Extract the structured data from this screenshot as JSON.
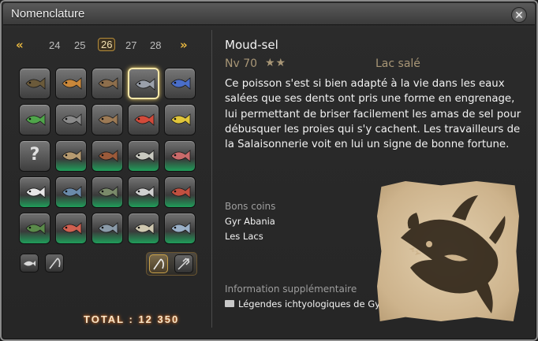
{
  "window": {
    "title": "Nomenclature",
    "close_icon": "crossed-close-icon"
  },
  "pager": {
    "prev_icon": "double-left-arrow-icon",
    "next_icon": "double-right-arrow-icon",
    "pages": [
      "24",
      "25",
      "26",
      "27",
      "28"
    ],
    "active_page": "26"
  },
  "grid": {
    "slots": [
      {
        "icon": "catfish-icon",
        "color": "#6b5a3a",
        "highlight": false,
        "selected": false
      },
      {
        "icon": "orange-fish-icon",
        "color": "#c9873a",
        "highlight": false,
        "selected": false
      },
      {
        "icon": "crab-icon",
        "color": "#8d6e4c",
        "highlight": false,
        "selected": false
      },
      {
        "icon": "gear-fish-icon",
        "color": "#9aa0aa",
        "highlight": false,
        "selected": true
      },
      {
        "icon": "blue-eel-icon",
        "color": "#4a6ec9",
        "highlight": false,
        "selected": false
      },
      {
        "icon": "green-dragon-fish-icon",
        "color": "#4fa54a",
        "highlight": false,
        "selected": false
      },
      {
        "icon": "grey-fish-icon",
        "color": "#8a8a8a",
        "highlight": false,
        "selected": false
      },
      {
        "icon": "octopus-icon",
        "color": "#9c7a55",
        "highlight": false,
        "selected": false
      },
      {
        "icon": "red-fish-icon",
        "color": "#d24a3a",
        "highlight": false,
        "selected": false
      },
      {
        "icon": "yellow-fish-icon",
        "color": "#e0c53a",
        "highlight": false,
        "selected": false
      },
      {
        "icon": "unknown-fish-icon",
        "color": "#7a5a6a",
        "highlight": false,
        "selected": false
      },
      {
        "icon": "tan-fish-icon",
        "color": "#b69a70",
        "highlight": true,
        "selected": false
      },
      {
        "icon": "brown-fish-icon",
        "color": "#9b5a3a",
        "highlight": true,
        "selected": false
      },
      {
        "icon": "silver-fish-icon",
        "color": "#c9c9c0",
        "highlight": true,
        "selected": false
      },
      {
        "icon": "rainbow-fish-icon",
        "color": "#c96a6a",
        "highlight": true,
        "selected": false
      },
      {
        "icon": "striped-fish-icon",
        "color": "#e6e6e6",
        "highlight": true,
        "selected": false
      },
      {
        "icon": "blue-ray-icon",
        "color": "#6a8aaa",
        "highlight": true,
        "selected": false
      },
      {
        "icon": "dark-fish-icon",
        "color": "#7a8a6a",
        "highlight": true,
        "selected": false
      },
      {
        "icon": "white-fish-icon",
        "color": "#d0d0d0",
        "highlight": true,
        "selected": false
      },
      {
        "icon": "red-crustacean-icon",
        "color": "#c05040",
        "highlight": true,
        "selected": false
      },
      {
        "icon": "green-catfish-icon",
        "color": "#5a8a4a",
        "highlight": true,
        "selected": false
      },
      {
        "icon": "red-snapper-icon",
        "color": "#d06050",
        "highlight": true,
        "selected": false
      },
      {
        "icon": "shark-icon",
        "color": "#8a9aa8",
        "highlight": true,
        "selected": false
      },
      {
        "icon": "pale-fish-icon",
        "color": "#cfc8b0",
        "highlight": true,
        "selected": false
      },
      {
        "icon": "blue-white-fish-icon",
        "color": "#9ab0c8",
        "highlight": true,
        "selected": false
      }
    ]
  },
  "filters": {
    "fish_filter_icon": "fish-filter-icon",
    "rod_filter_icon": "fishing-rod-icon",
    "rod_toggle_icon": "rod-toggle-icon",
    "spear_toggle_icon": "spear-toggle-icon"
  },
  "total": {
    "label": "TOTAL : 12 350"
  },
  "detail": {
    "name": "Moud-sel",
    "level": "Nv 70",
    "stars": "★★",
    "water_type": "Lac salé",
    "description": "Ce poisson s'est si bien adapté à la vie dans les eaux salées que ses dents ont pris une forme en engrenage, lui permettant de briser facilement les amas de sel pour débusquer les proies qui s'y cachent. Les travailleurs de la Salaisonnerie voit en lui un signe de bonne fortune.",
    "spots_label": "Bons coins",
    "spots": [
      "Gyr Abania",
      "Les Lacs"
    ],
    "extra_label": "Information supplémentaire",
    "extra_value": "Légendes ichtyologiques de Gyr Abania",
    "extra_icon": "book-icon",
    "illustration": "fish-sketch-parchment"
  },
  "colors": {
    "accent_gold": "#e9b840",
    "highlight_green": "#1f9e5a",
    "muted_label": "#a89676"
  }
}
